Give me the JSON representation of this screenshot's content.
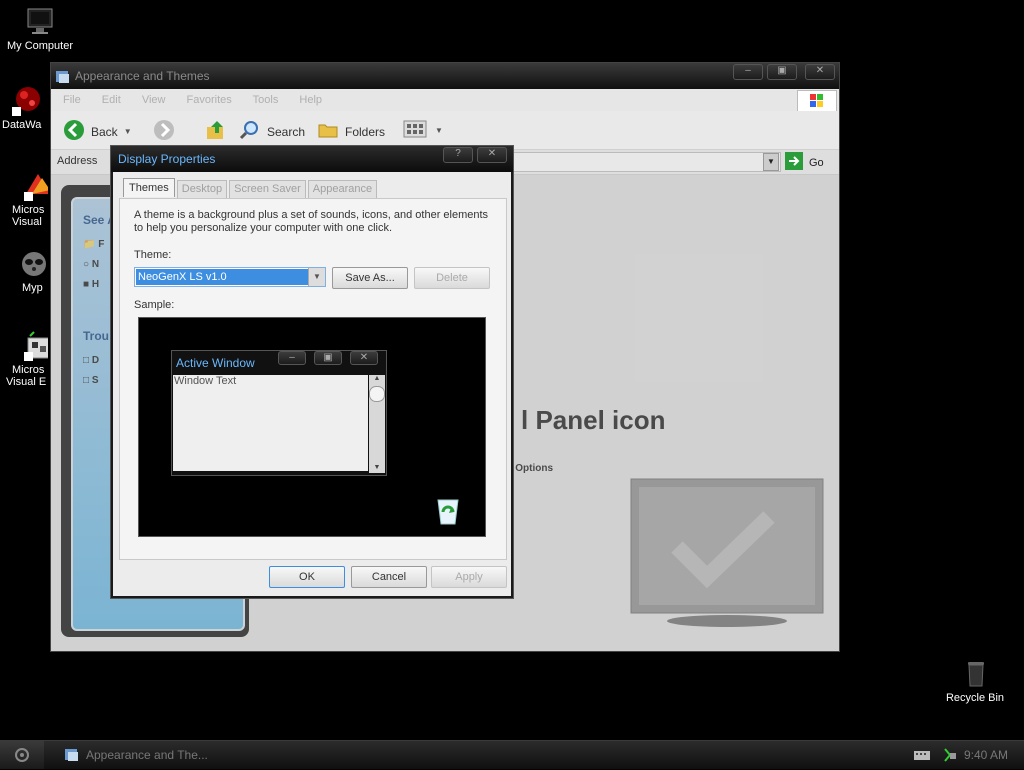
{
  "desktop": {
    "icons": [
      {
        "label": "My Computer",
        "icon": "monitor-icon"
      },
      {
        "label": "DataWa",
        "icon": "datawa-icon"
      },
      {
        "label": "Micros",
        "label2": "Visual",
        "icon": "visual-studio-icon"
      },
      {
        "label": "Myp",
        "icon": "raccoon-icon"
      },
      {
        "label": "Micros",
        "label2": "Visual E",
        "icon": "visual-basic-icon"
      },
      {
        "label": "Recycle Bin",
        "icon": "recycle-bin-icon"
      }
    ]
  },
  "explorer": {
    "title": "Appearance and Themes",
    "menu": [
      "File",
      "Edit",
      "View",
      "Favorites",
      "Tools",
      "Help"
    ],
    "toolbar": {
      "back": "Back",
      "search": "Search",
      "folders": "Folders"
    },
    "address": {
      "label": "Address",
      "go": "Go"
    },
    "sidebar": {
      "see_also": "See A",
      "see_also_items": [
        "F",
        "N",
        "H"
      ],
      "troubleshooters": "Trou",
      "trouble_items": [
        "D",
        "S"
      ]
    },
    "main": {
      "heading": "l Panel icon",
      "options_text": "er Options"
    }
  },
  "dialog": {
    "title": "Display Properties",
    "tabs": [
      "Themes",
      "Desktop",
      "Screen Saver",
      "Appearance"
    ],
    "active_tab": "Themes",
    "description": "A theme is a background plus a set of sounds, icons, and other elements to help you personalize your computer with one click.",
    "theme_label": "Theme:",
    "theme_value": "NeoGenX LS v1.0",
    "save_as": "Save As...",
    "delete": "Delete",
    "sample_label": "Sample:",
    "sample": {
      "window_title": "Active Window",
      "window_text": "Window Text"
    },
    "buttons": {
      "ok": "OK",
      "cancel": "Cancel",
      "apply": "Apply"
    }
  },
  "taskbar": {
    "task": "Appearance and The...",
    "clock": "9:40 AM"
  }
}
